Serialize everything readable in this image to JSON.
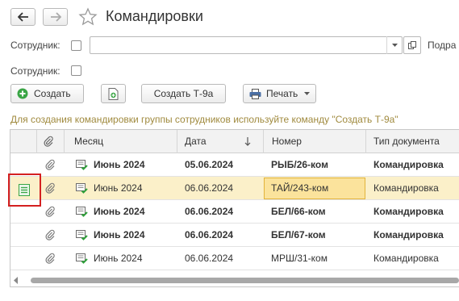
{
  "window": {
    "title": "Командировки"
  },
  "filters": {
    "employee_label_1": "Сотрудник:",
    "employee_label_2": "Сотрудник:",
    "department_label": "Подра"
  },
  "toolbar": {
    "create_label": "Создать",
    "create_t9a_label": "Создать Т-9а",
    "print_label": "Печать"
  },
  "hint": "Для создания командировки группы сотрудников используйте команду \"Создать Т-9а\"",
  "table": {
    "columns": [
      "Месяц",
      "Дата",
      "Номер",
      "Тип документа"
    ],
    "rows": [
      {
        "month": "Июнь 2024",
        "date": "05.06.2024",
        "number": "РЫБ/26-ком",
        "type": "Командировка",
        "bold": true,
        "selected": false
      },
      {
        "month": "Июнь 2024",
        "date": "06.06.2024",
        "number": "ТАЙ/243-ком",
        "type": "Командировка",
        "bold": false,
        "selected": true
      },
      {
        "month": "Июнь 2024",
        "date": "06.06.2024",
        "number": "БЕЛ/66-ком",
        "type": "Командировка",
        "bold": true,
        "selected": false
      },
      {
        "month": "Июнь 2024",
        "date": "06.06.2024",
        "number": "БЕЛ/67-ком",
        "type": "Командировка",
        "bold": true,
        "selected": false
      },
      {
        "month": "Июнь 2024",
        "date": "06.06.2024",
        "number": "МРШ/31-ком",
        "type": "Командировка",
        "bold": false,
        "selected": false
      }
    ]
  },
  "colors": {
    "accent_selected_row": "#fbf0c9",
    "active_cell": "#fbe39c",
    "hint_text": "#a08a3e",
    "highlight_frame": "#d42020"
  }
}
